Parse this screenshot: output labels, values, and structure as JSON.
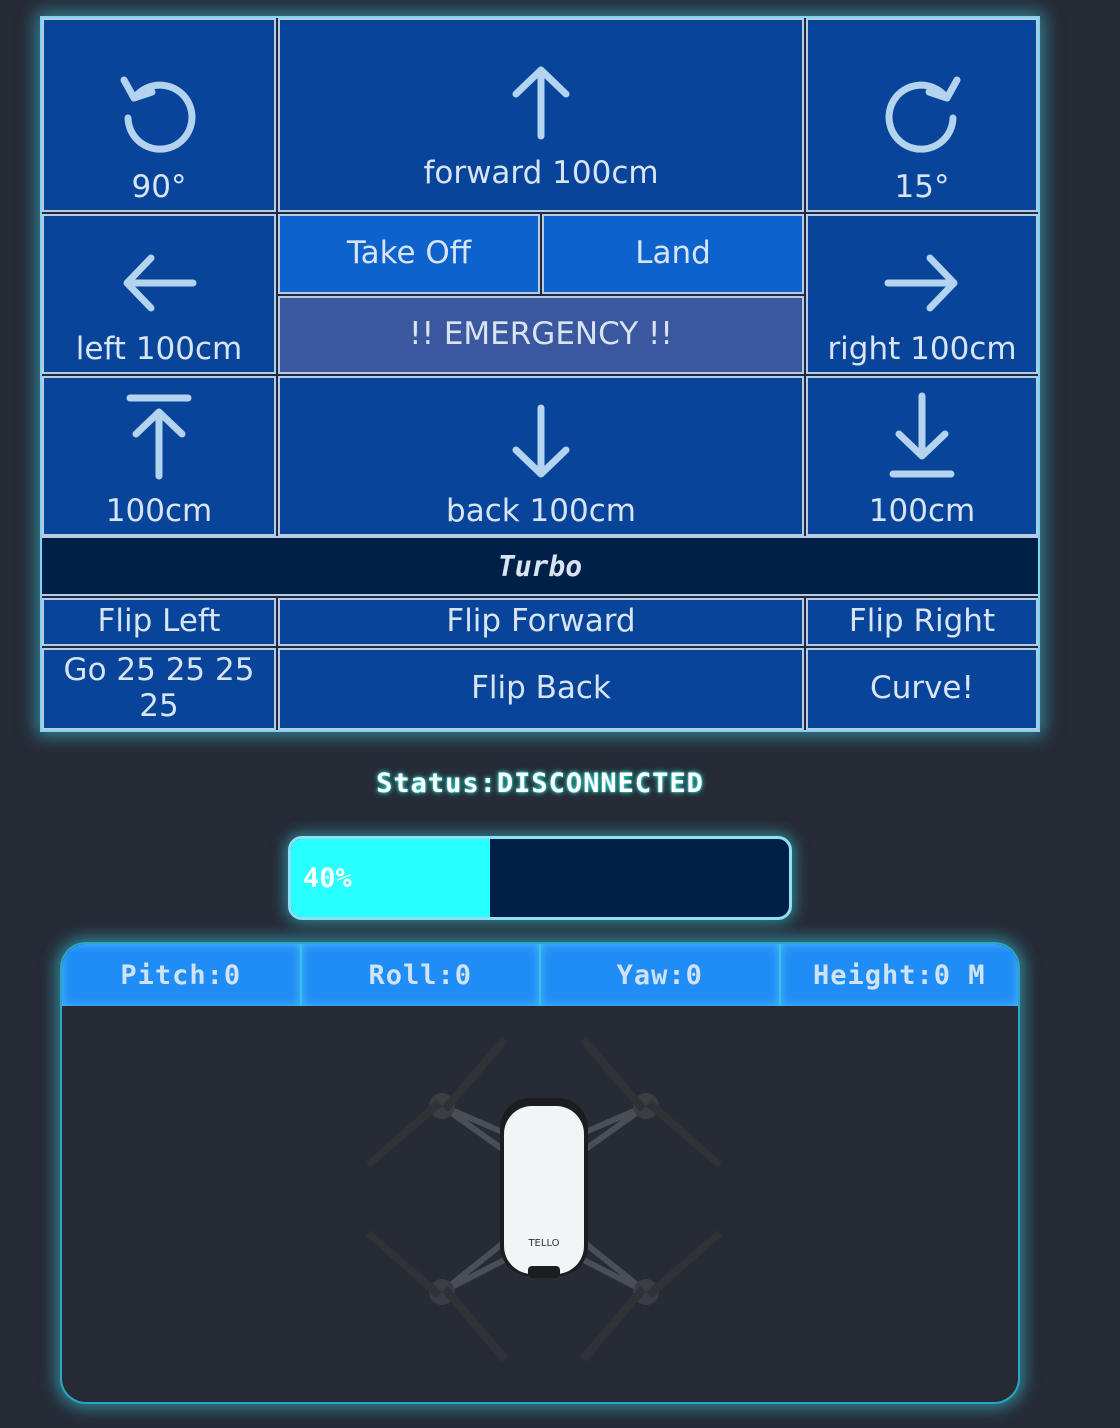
{
  "controls": {
    "rotate_ccw": {
      "label": "90°",
      "icon": "rotate-ccw-icon"
    },
    "forward": {
      "label": "forward 100cm",
      "icon": "arrow-up-icon"
    },
    "rotate_cw": {
      "label": "15°",
      "icon": "rotate-cw-icon"
    },
    "left": {
      "label": "left 100cm",
      "icon": "arrow-left-icon"
    },
    "takeoff": {
      "label": "Take Off"
    },
    "land": {
      "label": "Land"
    },
    "emergency": {
      "label": "!! EMERGENCY !!"
    },
    "right": {
      "label": "right 100cm",
      "icon": "arrow-right-icon"
    },
    "up": {
      "label": "100cm",
      "icon": "arrow-up-to-line-icon"
    },
    "back": {
      "label": "back 100cm",
      "icon": "arrow-down-icon"
    },
    "down": {
      "label": "100cm",
      "icon": "arrow-down-to-line-icon"
    },
    "turbo": {
      "label": "Turbo"
    },
    "flip_left": {
      "label": "Flip Left"
    },
    "flip_forward": {
      "label": "Flip Forward"
    },
    "flip_right": {
      "label": "Flip Right"
    },
    "go": {
      "label": "Go 25 25 25 25"
    },
    "flip_back": {
      "label": "Flip Back"
    },
    "curve": {
      "label": "Curve!"
    }
  },
  "status": {
    "text": "Status:DISCONNECTED"
  },
  "battery": {
    "percent": 40,
    "label": "40%"
  },
  "telemetry": {
    "pitch": "Pitch:0",
    "roll": "Roll:0",
    "yaw": "Yaw:0",
    "height": "Height:0 M"
  },
  "drone": {
    "brand": "TELLO"
  },
  "colors": {
    "background": "#262b36",
    "button": "#07449a",
    "button_bright": "#0d62cc",
    "emergency": "#3b579e",
    "turbo": "#002048",
    "battery_fill": "#28ffff",
    "telemetry_header": "#1f8df5"
  }
}
